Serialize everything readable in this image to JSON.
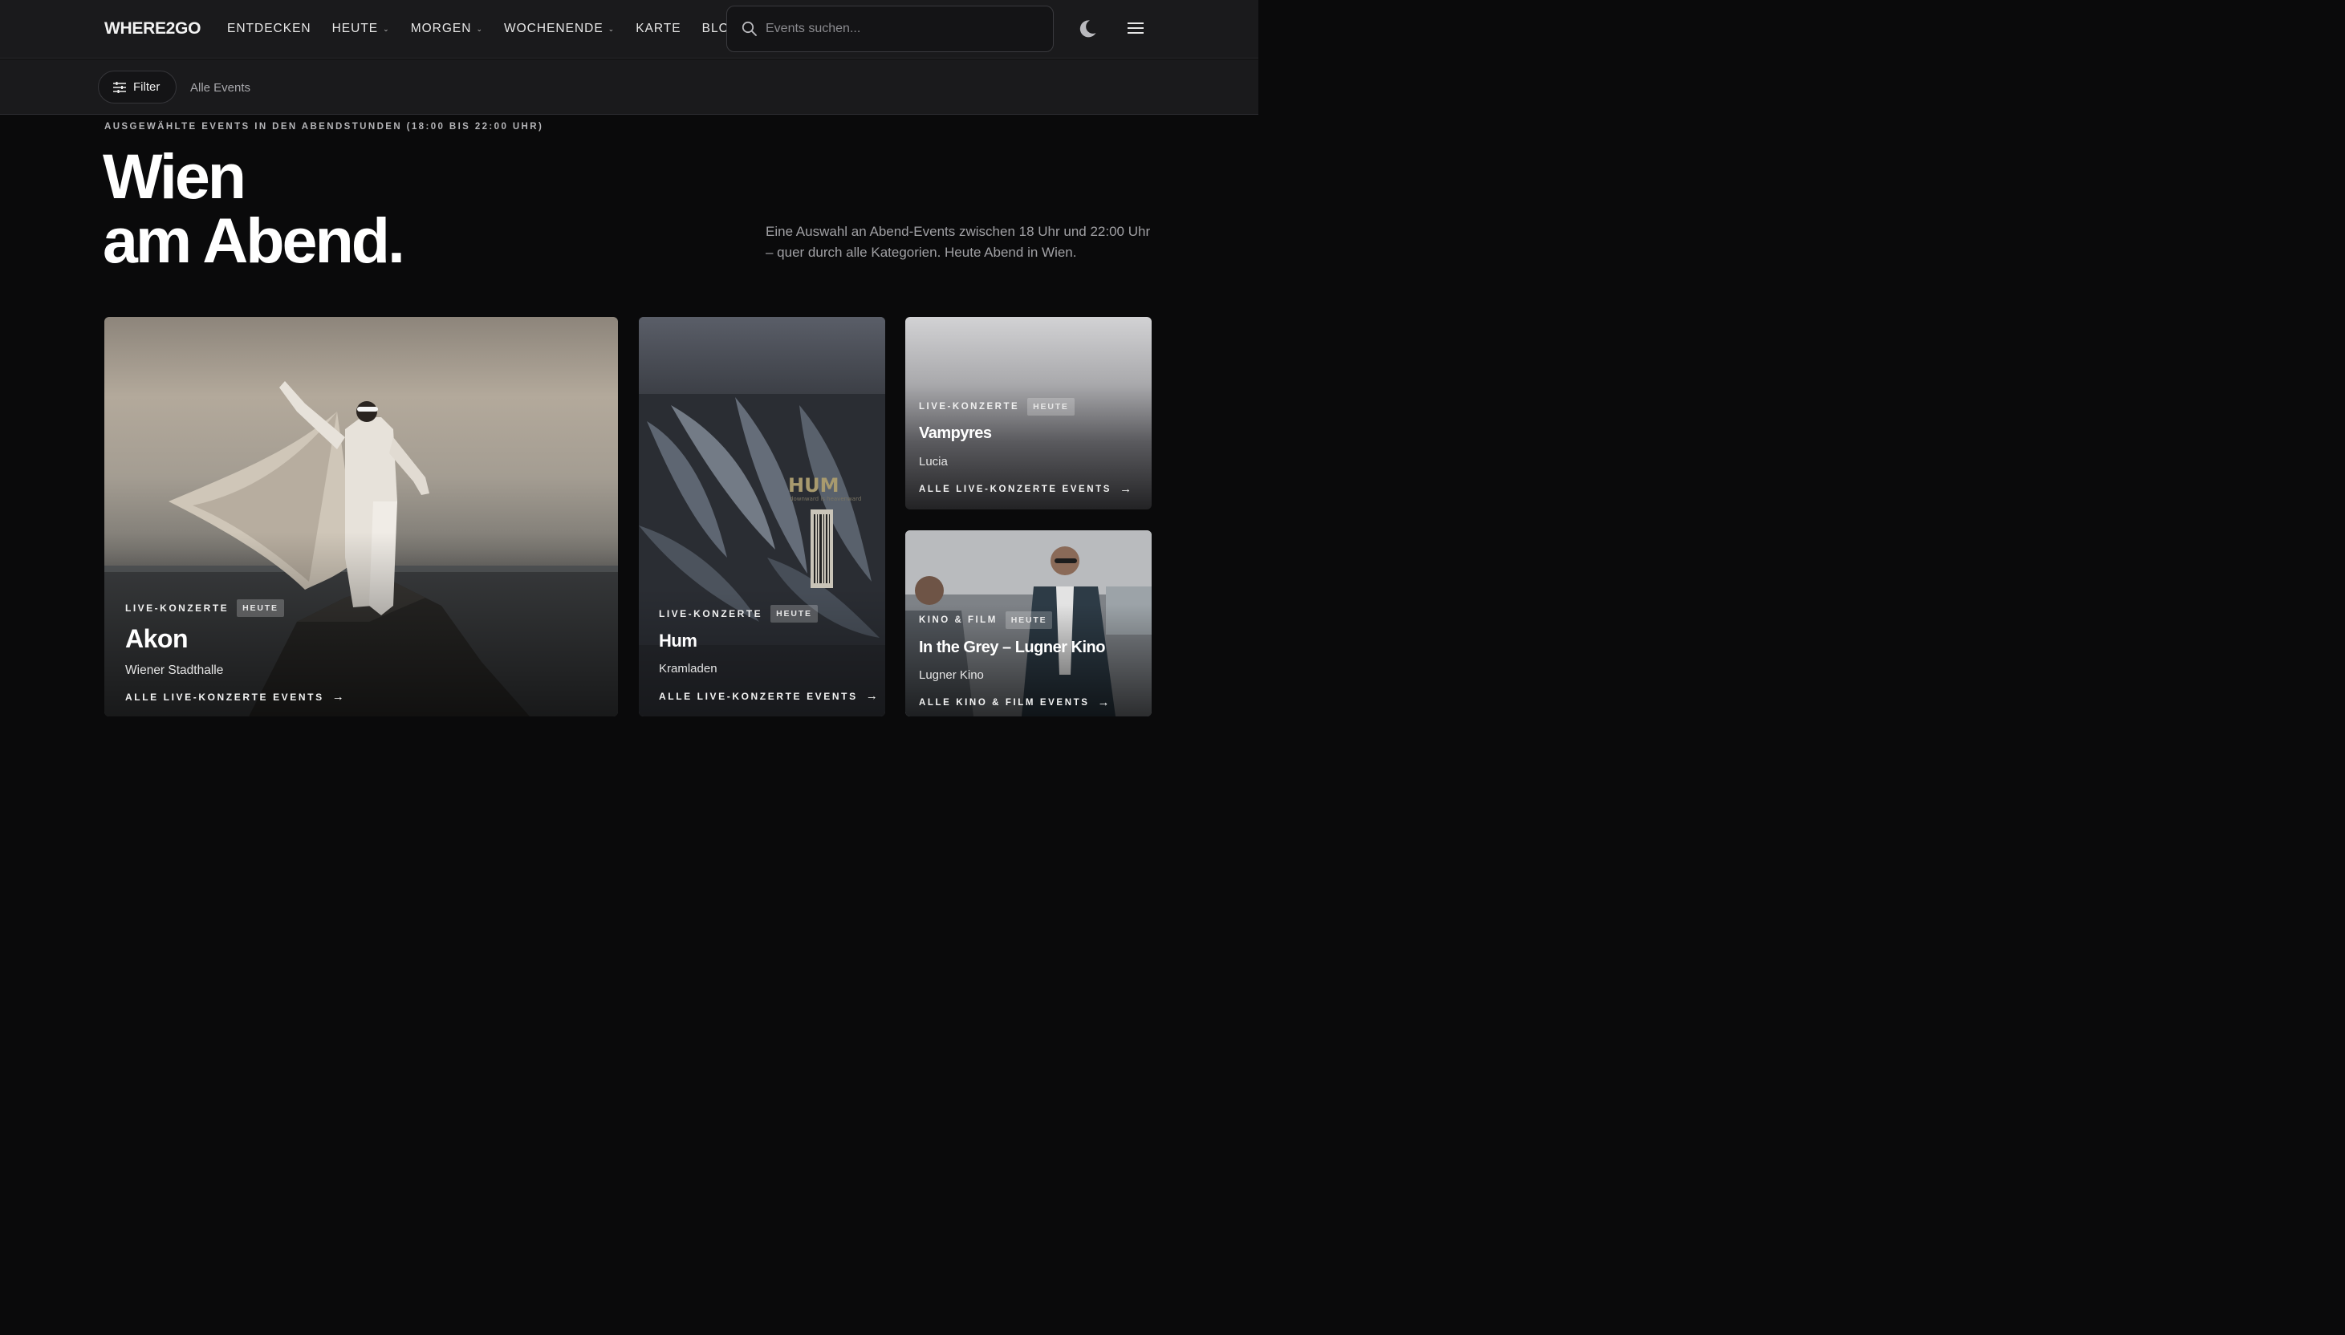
{
  "header": {
    "logo": "WHERE2GO",
    "nav": [
      {
        "label": "ENTDECKEN",
        "dropdown": false
      },
      {
        "label": "HEUTE",
        "dropdown": true
      },
      {
        "label": "MORGEN",
        "dropdown": true
      },
      {
        "label": "WOCHENENDE",
        "dropdown": true
      },
      {
        "label": "KARTE",
        "dropdown": false
      },
      {
        "label": "BLOG",
        "dropdown": false
      }
    ],
    "search_placeholder": "Events suchen...",
    "icons": {
      "search": "search-icon",
      "theme": "moon-icon",
      "menu": "hamburger-menu-icon"
    }
  },
  "filterbar": {
    "filter_label": "Filter",
    "all_events": "Alle Events"
  },
  "hero": {
    "eyebrow": "AUSGEWÄHLTE EVENTS IN DEN ABENDSTUNDEN (18:00 BIS 22:00 UHR)",
    "headline_line1": "Wien",
    "headline_line2": "am Abend.",
    "intro": "Eine Auswahl an Abend-Events zwischen 18 Uhr und 22:00 Uhr – quer durch alle Kategorien. Heute Abend in Wien."
  },
  "cards": [
    {
      "category": "LIVE-KONZERTE",
      "badge": "HEUTE",
      "title": "Akon",
      "venue": "Wiener Stadthalle",
      "link": "ALLE LIVE-KONZERTE EVENTS"
    },
    {
      "category": "LIVE-KONZERTE",
      "badge": "HEUTE",
      "title": "Hum",
      "venue": "Kramladen",
      "link": "ALLE LIVE-KONZERTE EVENTS",
      "cover_text": "HUM",
      "cover_subtitle": "downward is heavenward"
    },
    {
      "category": "LIVE-KONZERTE",
      "badge": "HEUTE",
      "title": "Vampyres",
      "venue": "Lucia",
      "link": "ALLE LIVE-KONZERTE EVENTS"
    },
    {
      "category": "KINO & FILM",
      "badge": "HEUTE",
      "title": "In the Grey – Lugner Kino",
      "venue": "Lugner Kino",
      "link": "ALLE KINO & FILM EVENTS"
    }
  ],
  "colors": {
    "background": "#0a0a0b",
    "bar": "#1a1a1c",
    "text": "#ffffff",
    "muted": "#a0a0a4"
  }
}
